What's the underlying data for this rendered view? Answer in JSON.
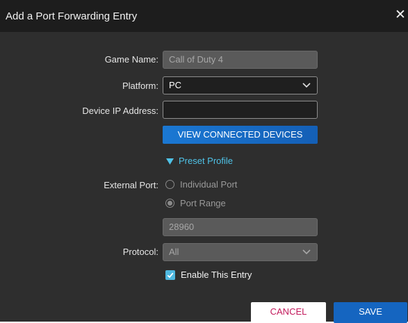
{
  "dialog": {
    "title": "Add a Port Forwarding Entry",
    "close_label": "✕"
  },
  "form": {
    "game_name": {
      "label": "Game Name:",
      "value": "Call of Duty 4"
    },
    "platform": {
      "label": "Platform:",
      "value": "PC"
    },
    "device_ip": {
      "label": "Device IP Address:",
      "value": ""
    },
    "view_devices_label": "VIEW CONNECTED DEVICES",
    "preset_profile_label": "Preset Profile",
    "external_port": {
      "label": "External Port:",
      "individual_label": "Individual Port",
      "range_label": "Port Range",
      "range_value": "28960"
    },
    "protocol": {
      "label": "Protocol:",
      "value": "All"
    },
    "enable_entry_label": "Enable This Entry"
  },
  "actions": {
    "cancel_label": "CANCEL",
    "save_label": "SAVE"
  },
  "colors": {
    "accent_cyan": "#4fc3e8",
    "primary_blue": "#1565c0",
    "cancel_text": "#c2185b"
  }
}
